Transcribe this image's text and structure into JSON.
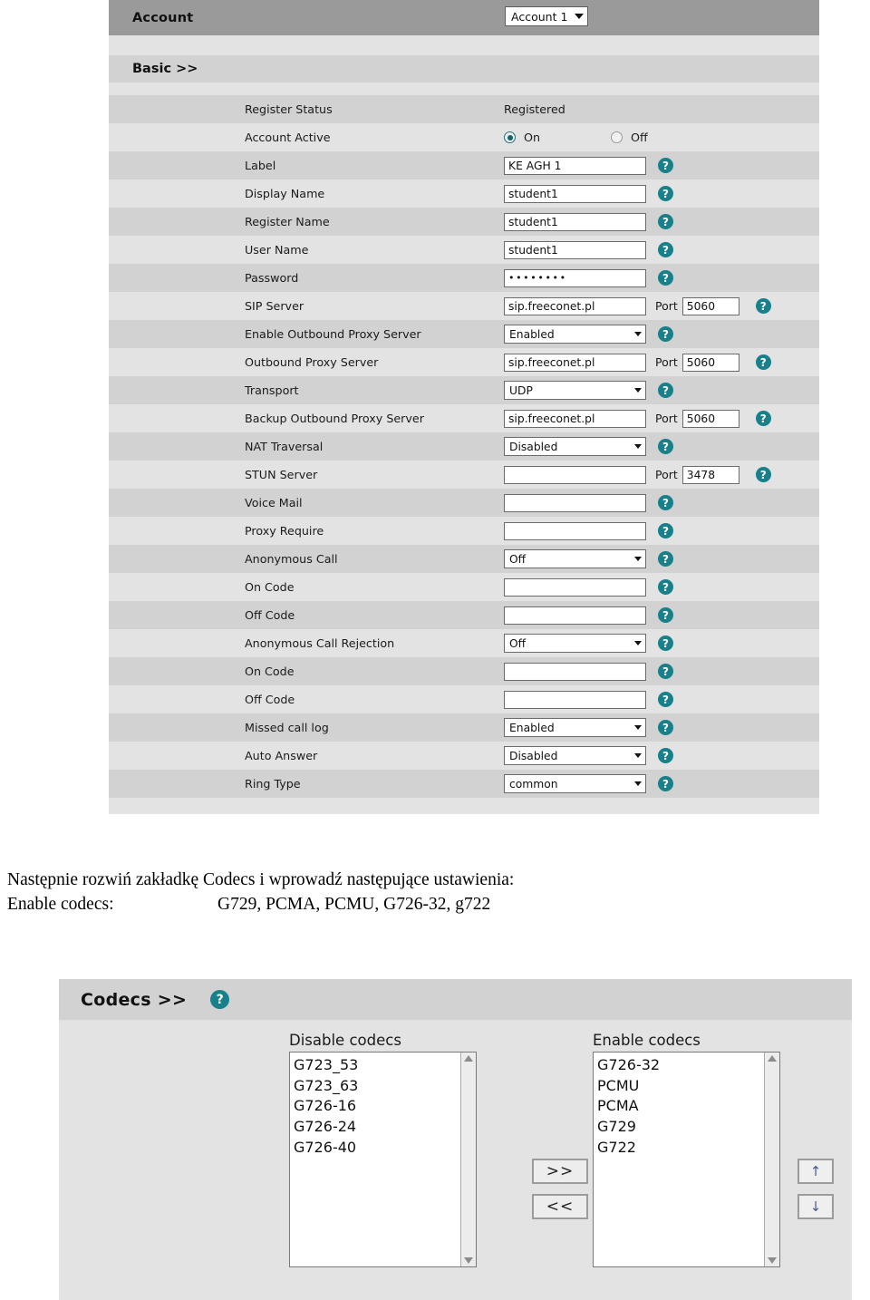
{
  "account_panel": {
    "header": {
      "title": "Account",
      "selected_account": "Account 1"
    },
    "section": {
      "title": "Basic >>"
    },
    "rows": [
      {
        "label": "Register Status",
        "type": "static",
        "value": "Registered",
        "help": false
      },
      {
        "label": "Account Active",
        "type": "radio",
        "on_label": "On",
        "off_label": "Off",
        "selected": "On",
        "help": false
      },
      {
        "label": "Label",
        "type": "text",
        "value": "KE AGH 1",
        "help": true
      },
      {
        "label": "Display Name",
        "type": "text",
        "value": "student1",
        "help": true
      },
      {
        "label": "Register Name",
        "type": "text",
        "value": "student1",
        "help": true
      },
      {
        "label": "User Name",
        "type": "text",
        "value": "student1",
        "help": true
      },
      {
        "label": "Password",
        "type": "password",
        "value": "••••••••",
        "help": true
      },
      {
        "label": "SIP Server",
        "type": "text",
        "value": "sip.freeconet.pl",
        "help": true,
        "port_label": "Port",
        "port_value": "5060"
      },
      {
        "label": "Enable Outbound Proxy Server",
        "type": "select",
        "value": "Enabled",
        "help": true
      },
      {
        "label": "Outbound Proxy Server",
        "type": "text",
        "value": "sip.freeconet.pl",
        "help": true,
        "port_label": "Port",
        "port_value": "5060"
      },
      {
        "label": "Transport",
        "type": "select",
        "value": "UDP",
        "help": true
      },
      {
        "label": "Backup Outbound Proxy Server",
        "type": "text",
        "value": "sip.freeconet.pl",
        "help": true,
        "port_label": "Port",
        "port_value": "5060"
      },
      {
        "label": "NAT Traversal",
        "type": "select",
        "value": "Disabled",
        "help": true
      },
      {
        "label": "STUN Server",
        "type": "text",
        "value": "",
        "help": true,
        "port_label": "Port",
        "port_value": "3478"
      },
      {
        "label": "Voice Mail",
        "type": "text",
        "value": "",
        "help": true
      },
      {
        "label": "Proxy Require",
        "type": "text",
        "value": "",
        "help": true
      },
      {
        "label": "Anonymous Call",
        "type": "select",
        "value": "Off",
        "help": true
      },
      {
        "label": "On Code",
        "type": "text",
        "value": "",
        "help": true
      },
      {
        "label": "Off Code",
        "type": "text",
        "value": "",
        "help": true
      },
      {
        "label": "Anonymous Call Rejection",
        "type": "select",
        "value": "Off",
        "help": true
      },
      {
        "label": "On Code",
        "type": "text",
        "value": "",
        "help": true
      },
      {
        "label": "Off Code",
        "type": "text",
        "value": "",
        "help": true
      },
      {
        "label": "Missed call log",
        "type": "select",
        "value": "Enabled",
        "help": true
      },
      {
        "label": "Auto Answer",
        "type": "select",
        "value": "Disabled",
        "help": true
      },
      {
        "label": "Ring Type",
        "type": "select",
        "value": "common",
        "help": true
      }
    ]
  },
  "instructions": {
    "line1": "Następnie rozwiń zakładkę Codecs i wprowadź następujące ustawienia:",
    "line2_label": "Enable codecs:",
    "line2_value": "G729, PCMA, PCMU, G726-32, g722"
  },
  "codecs_panel": {
    "title": "Codecs >>",
    "disable": {
      "caption": "Disable codecs",
      "items": [
        "G723_53",
        "G723_63",
        "G726-16",
        "G726-24",
        "G726-40"
      ]
    },
    "enable": {
      "caption": "Enable codecs",
      "items": [
        "G726-32",
        "PCMU",
        "PCMA",
        "G729",
        "G722"
      ]
    },
    "transfer": {
      "to_enable": ">>",
      "to_disable": "<<"
    },
    "order": {
      "up": "↑",
      "down": "↓"
    }
  },
  "icons": {
    "help": "?"
  },
  "colors": {
    "help_teal": "#17808a",
    "header_gray": "#9a9a9a",
    "row_dark": "#d2d2d2",
    "row_light": "#e3e3e3"
  }
}
